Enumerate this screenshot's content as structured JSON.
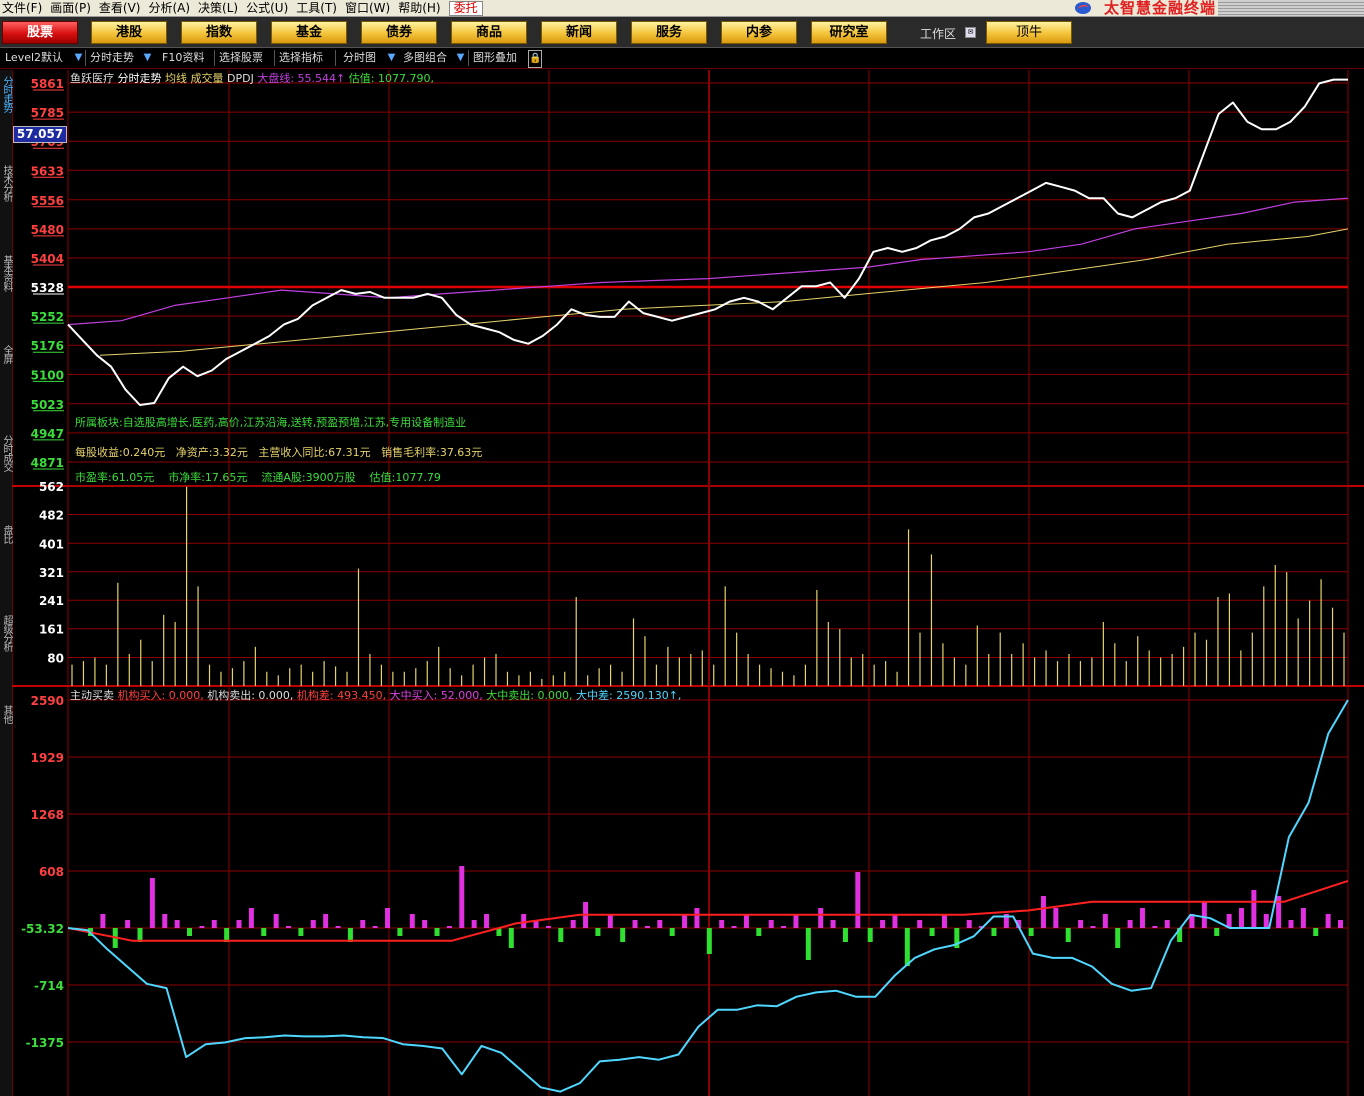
{
  "menu": {
    "items": [
      "文件(F)",
      "画面(P)",
      "查看(V)",
      "分析(A)",
      "决策(L)",
      "公式(U)",
      "工具(T)",
      "窗口(W)",
      "帮助(H)"
    ],
    "highlight": "委托",
    "brand": "太智慧金融终端"
  },
  "categories": [
    "股票",
    "港股",
    "指数",
    "基金",
    "债券",
    "商品",
    "新闻",
    "服务",
    "内参",
    "研究室"
  ],
  "active_category": "股票",
  "workspace": {
    "label": "工作区",
    "button": "顶牛"
  },
  "toolbar": {
    "level2": "Level2默认",
    "intraday": "分时走势",
    "f10": "F10资料",
    "select_stock": "选择股票",
    "select_indicator": "选择指标",
    "intraday_chart": "分时图",
    "multi_chart": "多图组合",
    "overlay": "图形叠加"
  },
  "side_tabs": [
    "分时走势",
    "技术分析",
    "基本资料",
    "全屏",
    "分时成交",
    "盘比",
    "超级分析",
    "其他"
  ],
  "price_panel": {
    "stock_name": "鱼跃医疗",
    "view": "分时走势",
    "avg_label": "均线",
    "volume_label": "成交量",
    "dpdj": "DPDJ",
    "index_text": "大盘线: 55.544↑",
    "estimate_text": "估值: 1077.790,",
    "current_price": "57.057",
    "y_labels": [
      "5861",
      "5785",
      "5709",
      "5633",
      "5556",
      "5480",
      "5404",
      "5328",
      "5252",
      "5176",
      "5100",
      "5023",
      "4947",
      "4871"
    ],
    "baseline": "5328"
  },
  "fundamentals": {
    "sector": "所属板块:自选股高增长,医药,高价,江苏沿海,送转,预盈预增,江苏,专用设备制造业",
    "eps": "每股收益:0.240元",
    "bvps": "净资产:3.32元",
    "revenue_yoy": "主营收入同比:67.31元",
    "gross_margin": "销售毛利率:37.63元",
    "pe": "市盈率:61.05元",
    "pb": "市净率:17.65元",
    "float_shares": "流通A股:3900万股",
    "valuation": "估值:1077.79"
  },
  "volume_panel": {
    "y_labels": [
      "562",
      "482",
      "401",
      "321",
      "241",
      "161",
      "80"
    ]
  },
  "flow_panel": {
    "title": "主动买卖",
    "inst_buy": "机构买入: 0.000,",
    "inst_sell": "机构卖出: 0.000,",
    "inst_diff": "机构差: 493.450,",
    "big_buy": "大中买入: 52.000,",
    "big_sell": "大中卖出: 0.000,",
    "big_diff": "大中差: 2590.130↑,",
    "y_labels": [
      "2590",
      "1929",
      "1268",
      "608",
      "-53.32",
      "-714",
      "-1375"
    ]
  },
  "colors": {
    "grid": "#8b0000",
    "price_line": "#ffffff",
    "avg_line": "#e6d36a",
    "index_line": "#c040e0",
    "up_label": "#ff4040",
    "down_label": "#3cdc3c",
    "flow_line": "#4fd7ff",
    "inst_line": "#ff2020"
  },
  "chart_data": [
    {
      "type": "line",
      "series": [
        {
          "name": "分时走势",
          "values": [
            5230,
            5190,
            5150,
            5120,
            5060,
            5020,
            5025,
            5090,
            5120,
            5095,
            5110,
            5140,
            5160,
            5180,
            5200,
            5230,
            5245,
            5280,
            5300,
            5320,
            5310,
            5315,
            5300,
            5300,
            5300,
            5310,
            5300,
            5255,
            5230,
            5220,
            5210,
            5190,
            5180,
            5200,
            5230,
            5270,
            5255,
            5250,
            5250,
            5290,
            5260,
            5250,
            5240,
            5250,
            5260,
            5270,
            5290,
            5300,
            5290,
            5270,
            5300,
            5330,
            5330,
            5340,
            5300,
            5350,
            5420,
            5430,
            5420,
            5430,
            5450,
            5460,
            5480,
            5510,
            5520,
            5540,
            5560,
            5580,
            5600,
            5590,
            5580,
            5560,
            5560,
            5520,
            5510,
            5530,
            5550,
            5560,
            5580,
            5680,
            5780,
            5810,
            5760,
            5740,
            5740,
            5760,
            5800,
            5860,
            5870,
            5870
          ]
        },
        {
          "name": "均线",
          "values": [
            5150,
            5155,
            5160,
            5170,
            5180,
            5190,
            5200,
            5210,
            5220,
            5230,
            5240,
            5250,
            5260,
            5270,
            5275,
            5280,
            5285,
            5290,
            5300,
            5310,
            5320,
            5330,
            5340,
            5355,
            5370,
            5385,
            5400,
            5420,
            5440,
            5450,
            5460,
            5480
          ]
        },
        {
          "name": "大盘线",
          "values": [
            5230,
            5240,
            5280,
            5300,
            5320,
            5310,
            5300,
            5310,
            5320,
            5330,
            5340,
            5345,
            5350,
            5360,
            5370,
            5380,
            5400,
            5410,
            5420,
            5440,
            5480,
            5500,
            5520,
            5550,
            5560
          ]
        }
      ]
    },
    {
      "type": "bar",
      "series": [
        {
          "name": "成交量",
          "values": [
            60,
            70,
            80,
            60,
            290,
            90,
            130,
            70,
            200,
            180,
            560,
            280,
            60,
            40,
            50,
            70,
            110,
            40,
            30,
            50,
            60,
            40,
            70,
            55,
            40,
            330,
            90,
            60,
            40,
            40,
            50,
            70,
            110,
            50,
            30,
            60,
            80,
            90,
            40,
            30,
            40,
            20,
            30,
            40,
            250,
            30,
            50,
            60,
            40,
            190,
            140,
            60,
            110,
            80,
            90,
            100,
            60,
            280,
            150,
            90,
            60,
            50,
            40,
            30,
            60,
            270,
            180,
            160,
            80,
            90,
            60,
            70,
            40,
            440,
            150,
            370,
            120,
            80,
            60,
            170,
            90,
            150,
            90,
            120,
            80,
            100,
            70,
            90,
            70,
            80,
            180,
            120,
            70,
            140,
            100,
            80,
            90,
            110,
            150,
            130,
            250,
            260,
            100,
            150,
            280,
            340,
            320,
            190,
            240,
            300,
            220,
            150
          ]
        }
      ]
    },
    {
      "type": "line",
      "series": [
        {
          "name": "大中差",
          "values": [
            -53,
            -80,
            -300,
            -500,
            -700,
            -750,
            -1550,
            -1400,
            -1380,
            -1330,
            -1320,
            -1300,
            -1310,
            -1310,
            -1300,
            -1320,
            -1330,
            -1400,
            -1420,
            -1450,
            -1750,
            -1420,
            -1500,
            -1700,
            -1900,
            -1950,
            -1850,
            -1600,
            -1580,
            -1550,
            -1580,
            -1520,
            -1200,
            -1000,
            -1000,
            -950,
            -960,
            -850,
            -800,
            -780,
            -850,
            -850,
            -600,
            -400,
            -300,
            -250,
            -150,
            80,
            80,
            -350,
            -400,
            -400,
            -500,
            -700,
            -780,
            -750,
            -200,
            100,
            60,
            -53,
            -53,
            -53,
            1000,
            1400,
            2200,
            2590
          ]
        },
        {
          "name": "机构差",
          "values": [
            -53,
            -200,
            -200,
            -200,
            -200,
            -200,
            -200,
            0,
            100,
            100,
            100,
            100,
            100,
            100,
            100,
            150,
            250,
            250,
            250,
            250,
            493
          ]
        }
      ]
    }
  ]
}
